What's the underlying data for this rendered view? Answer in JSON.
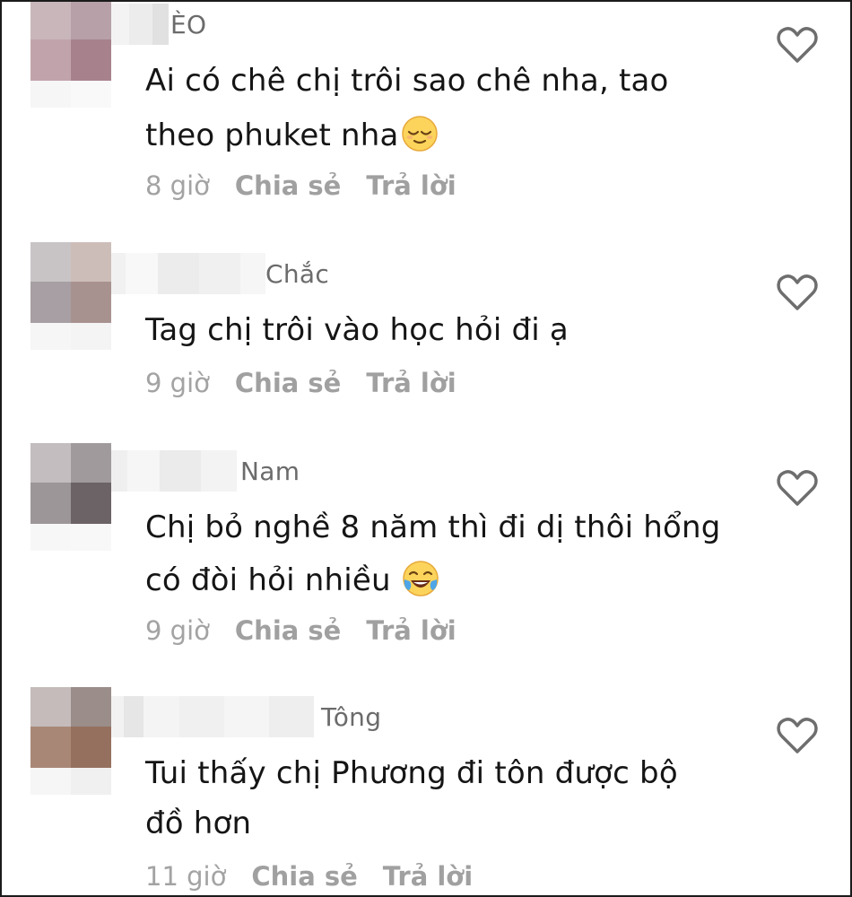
{
  "comments": [
    {
      "username": "ÈO",
      "lines": [
        "Ai có chê chị trôi sao chê nha, tao",
        "theo phuket nha"
      ],
      "emoji": "relieved-face-emoji",
      "time": "8 giờ",
      "share_label": "Chia sẻ",
      "reply_label": "Trả lời"
    },
    {
      "username": "Chắc",
      "lines": [
        "Tag chị trôi vào học hỏi đi ạ"
      ],
      "emoji": "",
      "time": "9 giờ",
      "share_label": "Chia sẻ",
      "reply_label": "Trả lời"
    },
    {
      "username": "Nam",
      "lines": [
        "Chị bỏ nghề 8 năm thì đi dị thôi hổng",
        "có đòi hỏi nhiều"
      ],
      "emoji": "tears-of-joy-emoji",
      "time": "9 giờ",
      "share_label": "Chia sẻ",
      "reply_label": "Trả lời"
    },
    {
      "username": "Tông",
      "lines": [
        "Tui thấy chị Phương đi tôn được bộ",
        "đồ hơn"
      ],
      "emoji": "",
      "time": "11 giờ",
      "share_label": "Chia sẻ",
      "reply_label": "Trả lời"
    }
  ],
  "icons": {
    "like": "heart-outline-icon"
  },
  "colors": {
    "text": "#151515",
    "username": "#6b6b6b",
    "meta": "#a3a3a3",
    "icon": "#6e6e6e",
    "border": "#1b1b1b"
  }
}
